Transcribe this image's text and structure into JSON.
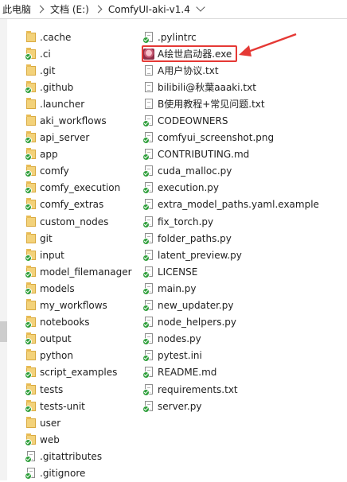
{
  "address_bar": {
    "crumbs": [
      "此电脑",
      "文档 (E:)",
      "ComfyUI-aki-v1.4"
    ]
  },
  "colors": {
    "highlight": "#e53935",
    "sync_ok": "#2f9f3b"
  },
  "left_column": [
    {
      "name": ".cache",
      "icon": "folder-icon",
      "sync": false
    },
    {
      "name": ".ci",
      "icon": "folder-icon",
      "sync": true
    },
    {
      "name": ".git",
      "icon": "folder-icon",
      "sync": false
    },
    {
      "name": ".github",
      "icon": "folder-icon",
      "sync": true
    },
    {
      "name": ".launcher",
      "icon": "folder-icon",
      "sync": false
    },
    {
      "name": "aki_workflows",
      "icon": "folder-icon",
      "sync": false
    },
    {
      "name": "api_server",
      "icon": "folder-icon",
      "sync": true
    },
    {
      "name": "app",
      "icon": "folder-icon",
      "sync": true
    },
    {
      "name": "comfy",
      "icon": "folder-icon",
      "sync": true
    },
    {
      "name": "comfy_execution",
      "icon": "folder-icon",
      "sync": true
    },
    {
      "name": "comfy_extras",
      "icon": "folder-icon",
      "sync": true
    },
    {
      "name": "custom_nodes",
      "icon": "folder-icon",
      "sync": false
    },
    {
      "name": "git",
      "icon": "folder-icon",
      "sync": false
    },
    {
      "name": "input",
      "icon": "folder-icon",
      "sync": true
    },
    {
      "name": "model_filemanager",
      "icon": "folder-icon",
      "sync": true
    },
    {
      "name": "models",
      "icon": "folder-icon",
      "sync": true
    },
    {
      "name": "my_workflows",
      "icon": "folder-icon",
      "sync": false
    },
    {
      "name": "notebooks",
      "icon": "folder-icon",
      "sync": true
    },
    {
      "name": "output",
      "icon": "folder-icon",
      "sync": true
    },
    {
      "name": "python",
      "icon": "folder-icon",
      "sync": false
    },
    {
      "name": "script_examples",
      "icon": "folder-icon",
      "sync": true
    },
    {
      "name": "tests",
      "icon": "folder-icon",
      "sync": true
    },
    {
      "name": "tests-unit",
      "icon": "folder-icon",
      "sync": true
    },
    {
      "name": "user",
      "icon": "folder-icon",
      "sync": false
    },
    {
      "name": "web",
      "icon": "folder-icon",
      "sync": true
    },
    {
      "name": ".gitattributes",
      "icon": "file-icon",
      "sync": true
    },
    {
      "name": ".gitignore",
      "icon": "file-icon",
      "sync": true
    }
  ],
  "right_column": [
    {
      "name": ".pylintrc",
      "icon": "file-icon",
      "sync": true
    },
    {
      "name": "A绘世启动器.exe",
      "icon": "launcher-exe-icon",
      "sync": false,
      "highlighted": true
    },
    {
      "name": "A用户协议.txt",
      "icon": "file-icon",
      "sync": false
    },
    {
      "name": "bilibili@秋葉aaaki.txt",
      "icon": "file-icon",
      "sync": false
    },
    {
      "name": "B使用教程+常见问题.txt",
      "icon": "file-icon",
      "sync": false
    },
    {
      "name": "CODEOWNERS",
      "icon": "file-icon",
      "sync": true
    },
    {
      "name": "comfyui_screenshot.png",
      "icon": "file-icon",
      "sync": true
    },
    {
      "name": "CONTRIBUTING.md",
      "icon": "file-icon",
      "sync": true
    },
    {
      "name": "cuda_malloc.py",
      "icon": "file-icon",
      "sync": true
    },
    {
      "name": "execution.py",
      "icon": "file-icon",
      "sync": true
    },
    {
      "name": "extra_model_paths.yaml.example",
      "icon": "file-icon",
      "sync": true
    },
    {
      "name": "fix_torch.py",
      "icon": "file-icon",
      "sync": true
    },
    {
      "name": "folder_paths.py",
      "icon": "file-icon",
      "sync": true
    },
    {
      "name": "latent_preview.py",
      "icon": "file-icon",
      "sync": true
    },
    {
      "name": "LICENSE",
      "icon": "file-icon",
      "sync": true
    },
    {
      "name": "main.py",
      "icon": "file-icon",
      "sync": true
    },
    {
      "name": "new_updater.py",
      "icon": "file-icon",
      "sync": true
    },
    {
      "name": "node_helpers.py",
      "icon": "file-icon",
      "sync": true
    },
    {
      "name": "nodes.py",
      "icon": "file-icon",
      "sync": true
    },
    {
      "name": "pytest.ini",
      "icon": "file-icon",
      "sync": true
    },
    {
      "name": "README.md",
      "icon": "file-icon",
      "sync": true
    },
    {
      "name": "requirements.txt",
      "icon": "file-icon",
      "sync": true
    },
    {
      "name": "server.py",
      "icon": "file-icon",
      "sync": true
    }
  ]
}
